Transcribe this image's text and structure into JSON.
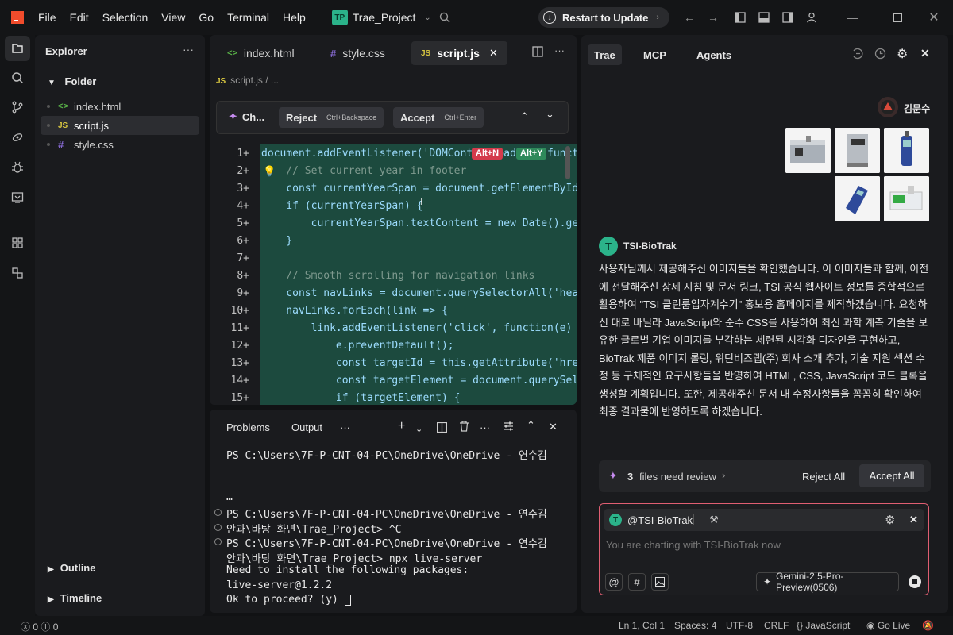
{
  "titlebar": {
    "menu": [
      "File",
      "Edit",
      "Selection",
      "View",
      "Go",
      "Terminal",
      "Help"
    ],
    "project_badge": "TP",
    "project_name": "Trae_Project",
    "update_label": "Restart to Update"
  },
  "explorer": {
    "title": "Explorer",
    "folder": "Folder",
    "files": [
      {
        "icon": "<>",
        "name": "index.html",
        "color": "#59b248"
      },
      {
        "icon": "JS",
        "name": "script.js",
        "color": "#d8c640"
      },
      {
        "icon": "#",
        "name": "style.css",
        "color": "#8a6cd8"
      }
    ],
    "outline": "Outline",
    "timeline": "Timeline"
  },
  "editor": {
    "tabs": [
      {
        "icon": "<>",
        "name": "index.html",
        "color": "#59b248"
      },
      {
        "icon": "#",
        "name": "style.css",
        "color": "#8a6cd8"
      },
      {
        "icon": "JS",
        "name": "script.js",
        "color": "#d8c640"
      }
    ],
    "breadcrumb_icon": "JS",
    "breadcrumb": "script.js",
    "breadcrumb_more": "/ ...",
    "diff": {
      "chat_label": "Ch...",
      "reject_label": "Reject",
      "reject_key": "Ctrl+Backspace",
      "accept_label": "Accept",
      "accept_key": "Ctrl+Enter"
    },
    "tag_reject": "Alt+N",
    "tag_accept": "Alt+Y",
    "lines": [
      {
        "n": "1+",
        "t": "document.addEventListener('DOMContentLoaded', function"
      },
      {
        "n": "2+",
        "t": "    // Set current year in footer"
      },
      {
        "n": "3+",
        "t": "    const currentYearSpan = document.getElementById("
      },
      {
        "n": "4+",
        "t": "    if (currentYearSpan) {"
      },
      {
        "n": "5+",
        "t": "        currentYearSpan.textContent = new Date().getFu"
      },
      {
        "n": "6+",
        "t": "    }"
      },
      {
        "n": "7+",
        "t": ""
      },
      {
        "n": "8+",
        "t": "    // Smooth scrolling for navigation links"
      },
      {
        "n": "9+",
        "t": "    const navLinks = document.querySelectorAll('hea"
      },
      {
        "n": "10+",
        "t": "    navLinks.forEach(link => {"
      },
      {
        "n": "11+",
        "t": "        link.addEventListener('click', function(e) {"
      },
      {
        "n": "12+",
        "t": "            e.preventDefault();"
      },
      {
        "n": "13+",
        "t": "            const targetId = this.getAttribute('hre"
      },
      {
        "n": "14+",
        "t": "            const targetElement = document.querySel"
      },
      {
        "n": "15+",
        "t": "            if (targetElement) {"
      }
    ]
  },
  "terminal": {
    "tabs": [
      "Problems",
      "Output"
    ],
    "lines": [
      "PS C:\\Users\\7F-P-CNT-04-PC\\OneDrive\\OneDrive - 연수김",
      "",
      "",
      "…",
      "PS C:\\Users\\7F-P-CNT-04-PC\\OneDrive\\OneDrive - 연수김",
      "안과\\바탕 화면\\Trae_Project> ^C",
      "PS C:\\Users\\7F-P-CNT-04-PC\\OneDrive\\OneDrive - 연수김",
      "안과\\바탕 화면\\Trae_Project> npx live-server",
      "Need to install the following packages:",
      "live-server@1.2.2",
      "Ok to proceed? (y) "
    ]
  },
  "chat": {
    "tabs": [
      "Trae",
      "MCP",
      "Agents"
    ],
    "user_name": "김문수",
    "agent_initial": "T",
    "agent_name": "TSI-BioTrak",
    "message": "사용자님께서 제공해주신 이미지들을 확인했습니다. 이 이미지들과 함께, 이전에 전달해주신 상세 지침 및 문서 링크, TSI 공식 웹사이트 정보를 종합적으로 활용하여 \"TSI 클린룸입자계수기\" 홍보용 홈페이지를 제작하겠습니다. 요청하신 대로 바닐라 JavaScript와 순수 CSS를 사용하여 최신 과학 계측 기술을 보유한 글로벌 기업 이미지를 부각하는 세련된 시각화 디자인을 구현하고, BioTrak 제품 이미지 롤링, 위딘비즈랩(주) 회사 소개 추가, 기술 지원 섹션 수정 등 구체적인 요구사항들을 반영하여 HTML, CSS, JavaScript 코드 블록을 생성할 계획입니다. 또한, 제공해주신 문서 내 수정사항들을 꼼꼼히 확인하여 최종 결과물에 반영하도록 하겠습니다.",
    "review_count": "3",
    "review_label": "files need review",
    "reject_all": "Reject All",
    "accept_all": "Accept All",
    "mention": "@TSI-BioTrak",
    "placeholder": "You are chatting with TSI-BioTrak now",
    "model": "Gemini-2.5-Pro-Preview(0506)"
  },
  "status": {
    "errors": "0",
    "warnings": "0",
    "position": "Ln 1, Col 1",
    "spaces": "Spaces: 4",
    "encoding": "UTF-8",
    "eol": "CRLF",
    "language": "JavaScript",
    "live": "Go Live"
  }
}
